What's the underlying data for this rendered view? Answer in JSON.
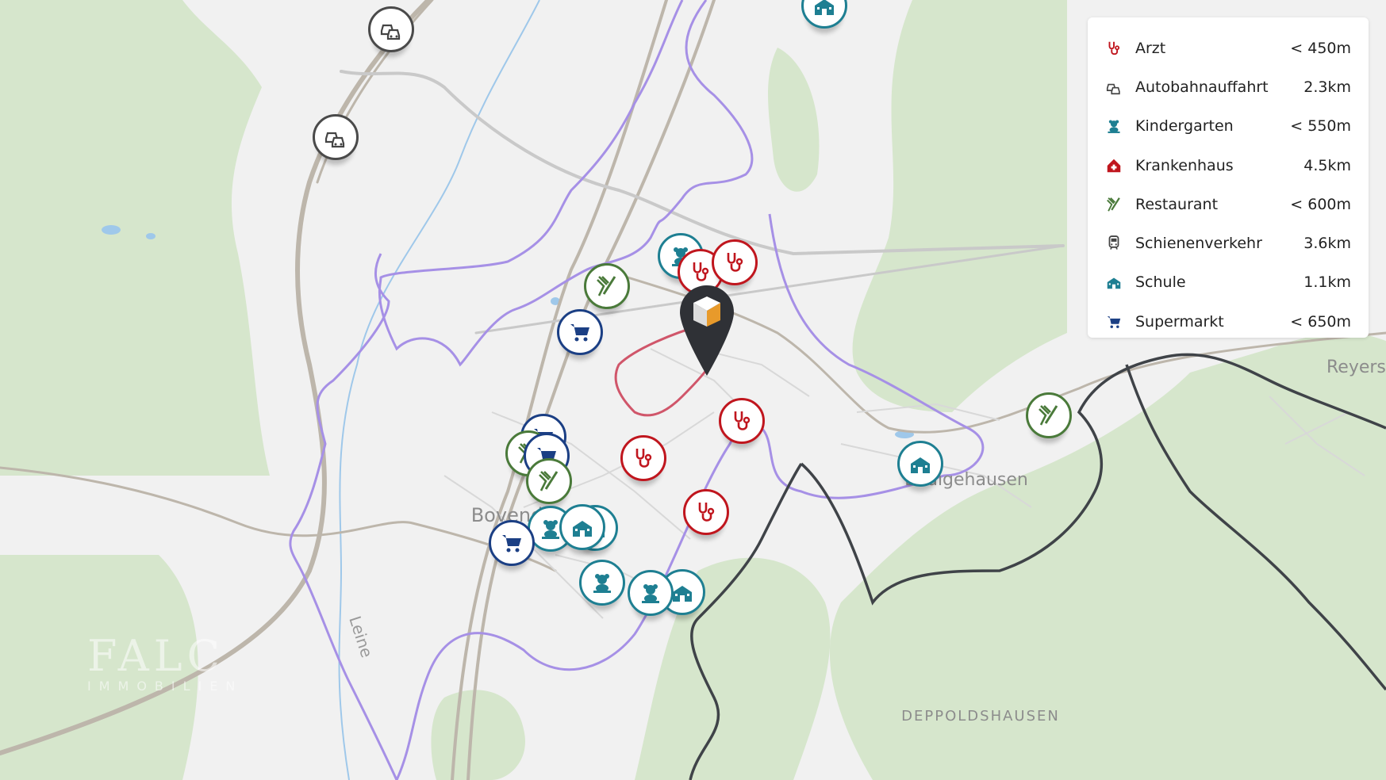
{
  "legend": {
    "items": [
      {
        "label": "Arzt",
        "distance": "< 450m",
        "icon": "stethoscope-icon",
        "color": "#c0161e"
      },
      {
        "label": "Autobahnauffahrt",
        "distance": "2.3km",
        "icon": "cars-icon",
        "color": "#444444"
      },
      {
        "label": "Kindergarten",
        "distance": "< 550m",
        "icon": "teddy-bear-icon",
        "color": "#1e7f92"
      },
      {
        "label": "Krankenhaus",
        "distance": "4.5km",
        "icon": "hospital-icon",
        "color": "#c0161e"
      },
      {
        "label": "Restaurant",
        "distance": "< 600m",
        "icon": "fork-knife-icon",
        "color": "#4a7a3a"
      },
      {
        "label": "Schienenverkehr",
        "distance": "3.6km",
        "icon": "train-icon",
        "color": "#444444"
      },
      {
        "label": "Schule",
        "distance": "1.1km",
        "icon": "school-icon",
        "color": "#1e7f92"
      },
      {
        "label": "Supermarkt",
        "distance": "< 650m",
        "icon": "cart-icon",
        "color": "#1b3f84"
      }
    ]
  },
  "places": {
    "bovenden": "Bovenden",
    "eddigehausen": "Eddigehausen",
    "deppoldshausen": "DEPPOLDSHAUSEN",
    "reyers": "Reyers",
    "river": "Leine"
  },
  "watermark": {
    "brand": "FALC",
    "sub": "IMMOBILIEN"
  },
  "colors": {
    "forest": "#d6e6cc",
    "road": "#bdb6ab",
    "isoline_purple": "#a690e6",
    "isoline_dark": "#3f4348",
    "isoline_red": "#d0566a",
    "water": "#9fc8ea",
    "marker": "#2f3136",
    "marker_accent": "#e89a2b"
  }
}
